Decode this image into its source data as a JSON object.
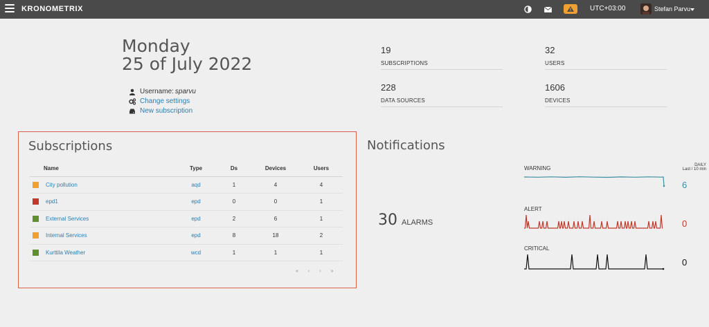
{
  "header": {
    "brand": "KRONOMETRIX",
    "timezone": "UTC+03:00",
    "user_name": "Stefan Parvu",
    "icons": [
      "menu-icon",
      "contrast-icon",
      "mail-icon",
      "warning-icon",
      "caret-down-icon"
    ],
    "alert_color": "#f0a030"
  },
  "date": {
    "weekday": "Monday",
    "full_date": "25 of July 2022"
  },
  "profile": {
    "username_label": "Username:",
    "username_value": "sparvu",
    "change_settings": "Change settings",
    "new_subscription": "New subscription"
  },
  "stats": [
    {
      "value": "19",
      "label": "SUBSCRIPTIONS"
    },
    {
      "value": "32",
      "label": "USERS"
    },
    {
      "value": "228",
      "label": "DATA SOURCES"
    },
    {
      "value": "1606",
      "label": "DEVICES"
    }
  ],
  "subscriptions": {
    "title": "Subscriptions",
    "columns": [
      "Name",
      "Type",
      "Ds",
      "Devices",
      "Users"
    ],
    "rows": [
      {
        "name": "City pollution",
        "type": "aqd",
        "ds": "1",
        "devices": "4",
        "users": "4",
        "color": "#f0a030"
      },
      {
        "name": "epd1",
        "type": "epd",
        "ds": "0",
        "devices": "0",
        "users": "1",
        "color": "#c0392b"
      },
      {
        "name": "External Services",
        "type": "epd",
        "ds": "2",
        "devices": "6",
        "users": "1",
        "color": "#5f8f2e"
      },
      {
        "name": "Internal Services",
        "type": "epd",
        "ds": "8",
        "devices": "18",
        "users": "2",
        "color": "#f0a030"
      },
      {
        "name": "Kurttila Weather",
        "type": "wcd",
        "ds": "1",
        "devices": "1",
        "users": "1",
        "color": "#5f8f2e"
      }
    ],
    "pager": [
      "«",
      "‹",
      "›",
      "»"
    ]
  },
  "notifications": {
    "title": "Notifications",
    "alarms_count": "30",
    "alarms_label": "ALARMS",
    "daily_label": "DAILY",
    "range_label": "Last / 10 min",
    "warning": {
      "label": "WARNING",
      "value": "6",
      "color": "#3a8fa0"
    },
    "alert": {
      "label": "ALERT",
      "value": "0",
      "color": "#c0392b"
    },
    "critical": {
      "label": "CRITICAL",
      "value": "0",
      "color": "#111111"
    }
  },
  "link_color": "#2a7fb0",
  "highlight_border": "#d9604a"
}
